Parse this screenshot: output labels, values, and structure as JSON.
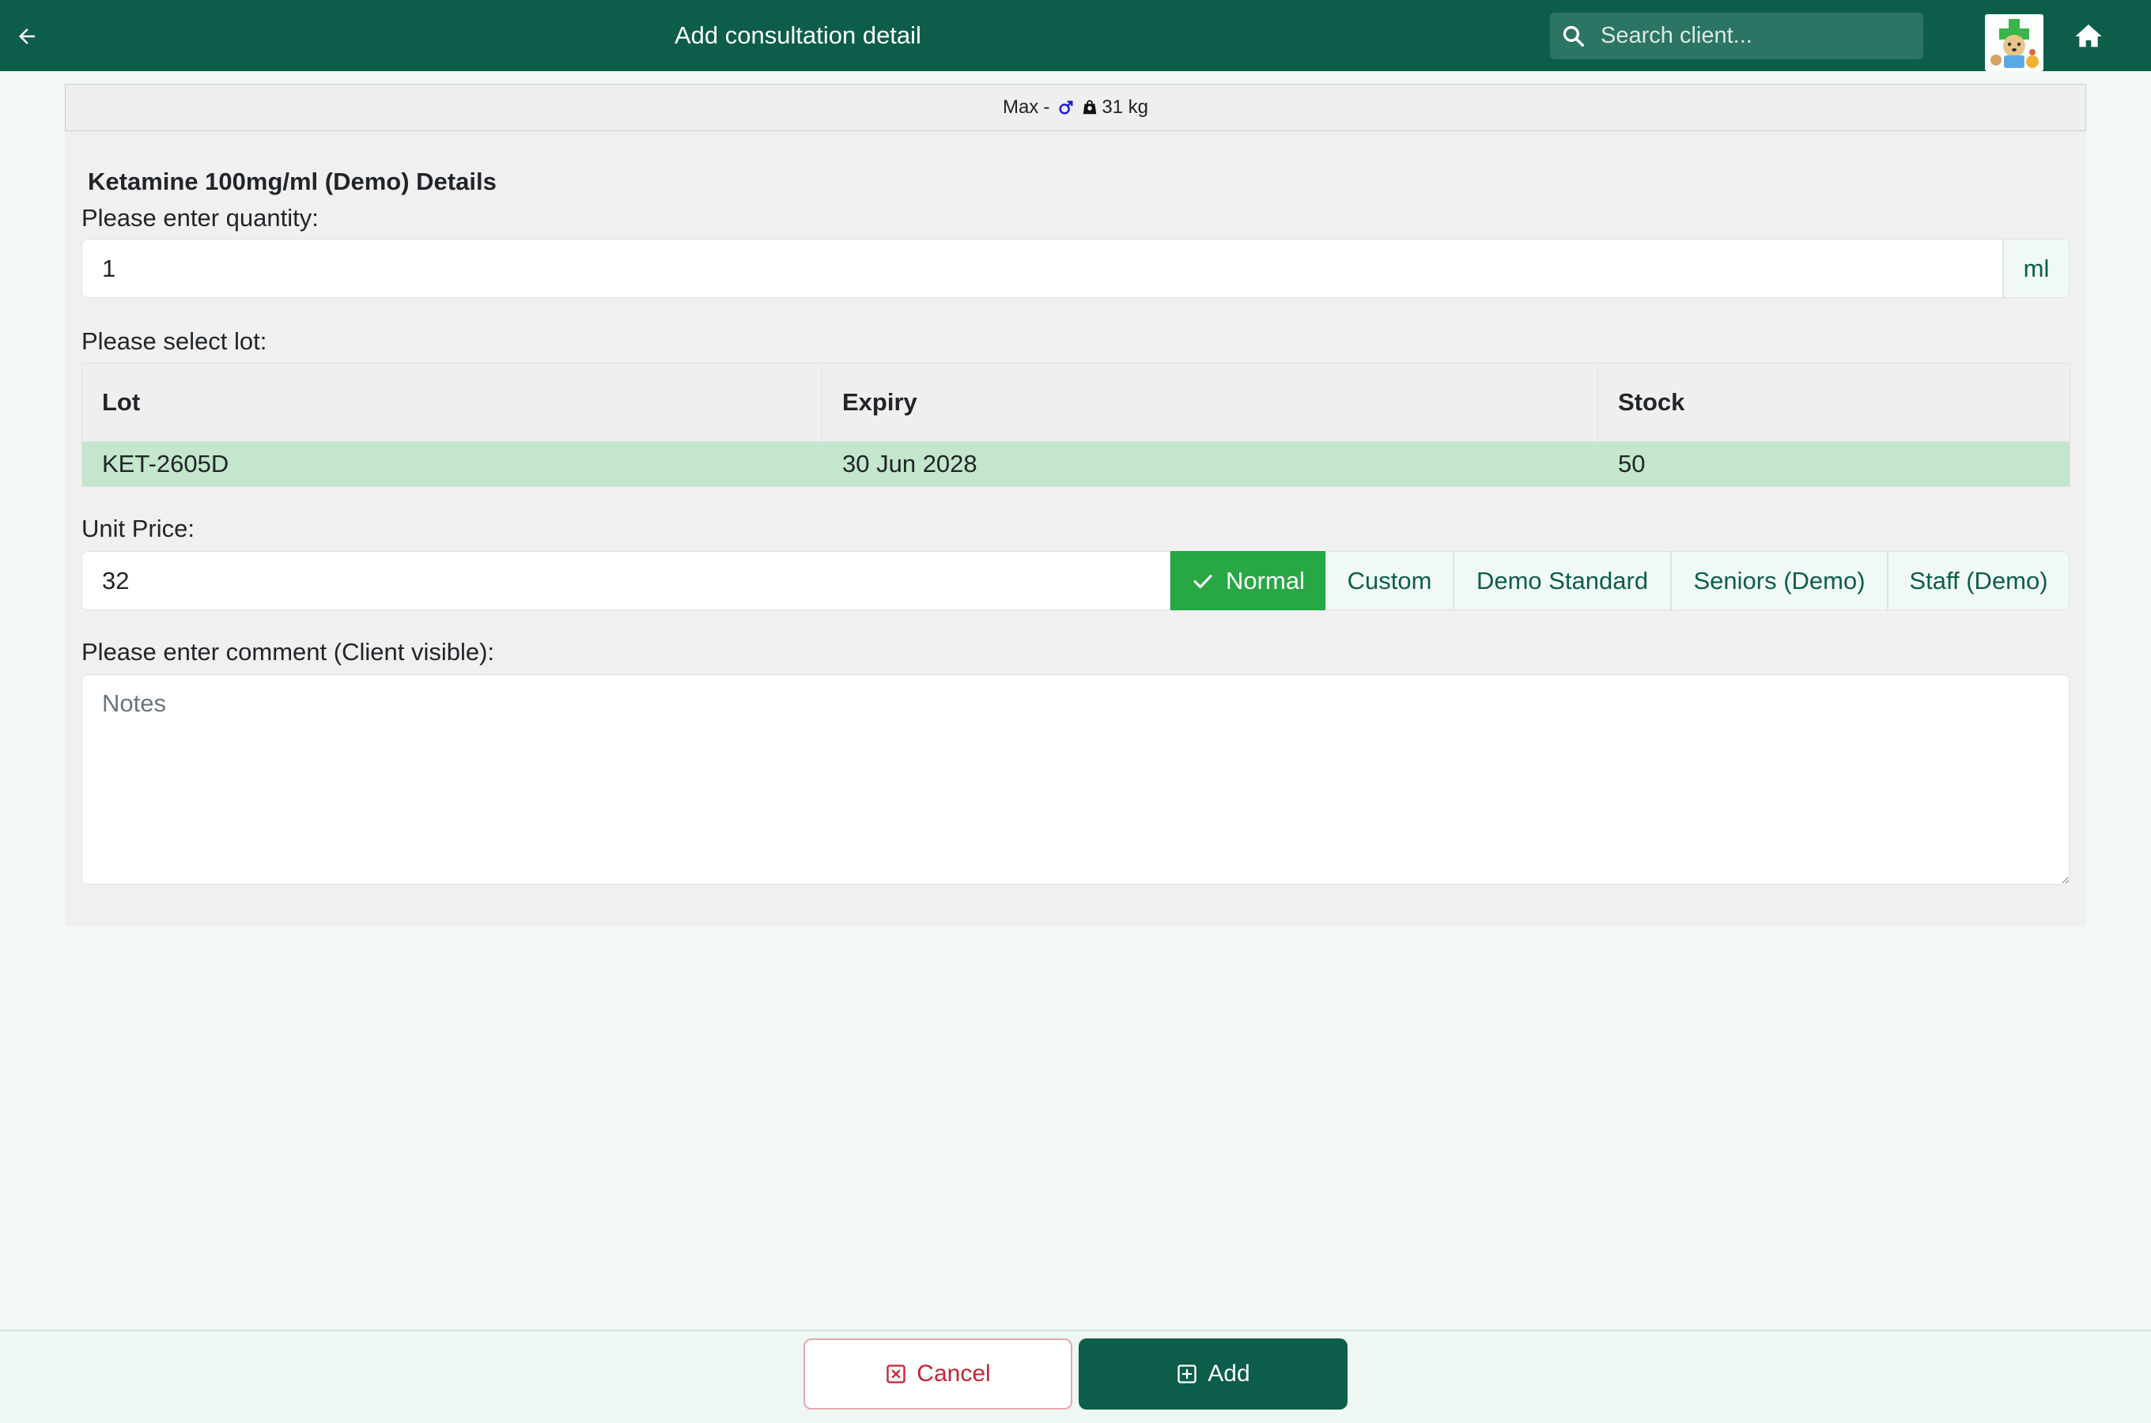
{
  "header": {
    "title": "Add consultation detail",
    "back_icon": "arrow-left-icon",
    "search_placeholder": "Search client...",
    "home_icon": "home-icon",
    "logo_icon": "clinic-logo"
  },
  "patient": {
    "name": "Max",
    "separator": "-",
    "sex_icon": "male-icon",
    "weight_icon": "weight-icon",
    "weight": "31 kg"
  },
  "details": {
    "title": "Ketamine 100mg/ml (Demo) Details",
    "quantity_label": "Please enter quantity:",
    "quantity_value": "1",
    "unit": "ml",
    "lot_label": "Please select lot:",
    "lot_table": {
      "headers": [
        "Lot",
        "Expiry",
        "Stock"
      ],
      "rows": [
        {
          "lot": "KET-2605D",
          "expiry": "30 Jun 2028",
          "stock": "50",
          "selected": true
        }
      ]
    },
    "price_label": "Unit Price:",
    "price_value": "32",
    "price_options": [
      "Normal",
      "Custom",
      "Demo Standard",
      "Seniors (Demo)",
      "Staff (Demo)"
    ],
    "price_selected": "Normal",
    "comment_label": "Please enter comment (Client visible):",
    "comment_placeholder": "Notes",
    "comment_value": ""
  },
  "footer": {
    "cancel_label": "Cancel",
    "add_label": "Add"
  },
  "colors": {
    "header_bg": "#0c5e4a",
    "selected_row": "#c3e6cc",
    "active_price": "#28a745",
    "cancel_red": "#c82333"
  }
}
